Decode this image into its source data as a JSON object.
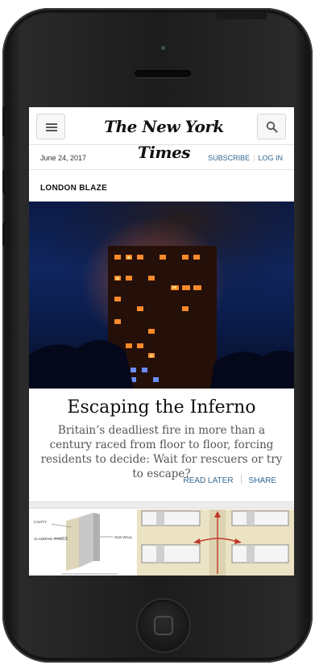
{
  "header": {
    "logo": "The New York Times",
    "menu_icon": "menu-icon",
    "search_icon": "search-icon"
  },
  "subbar": {
    "date": "June 24, 2017",
    "subscribe_label": "SUBSCRIBE",
    "login_label": "LOG IN"
  },
  "article": {
    "kicker": "LONDON BLAZE",
    "headline": "Escaping the Inferno",
    "summary": "Britain’s deadliest fire in more than a century raced from floor to floor, forcing residents to decide: Wait for rescuers or try to escape?",
    "read_later_label": "READ LATER",
    "share_label": "SHARE"
  },
  "diagram": {
    "labels": [
      "CAVITY",
      "CLADDING PANELS",
      "OLD WALL"
    ]
  },
  "colors": {
    "link": "#326891",
    "hero_sky": "#10265f",
    "fire": "#ff6a1a"
  }
}
